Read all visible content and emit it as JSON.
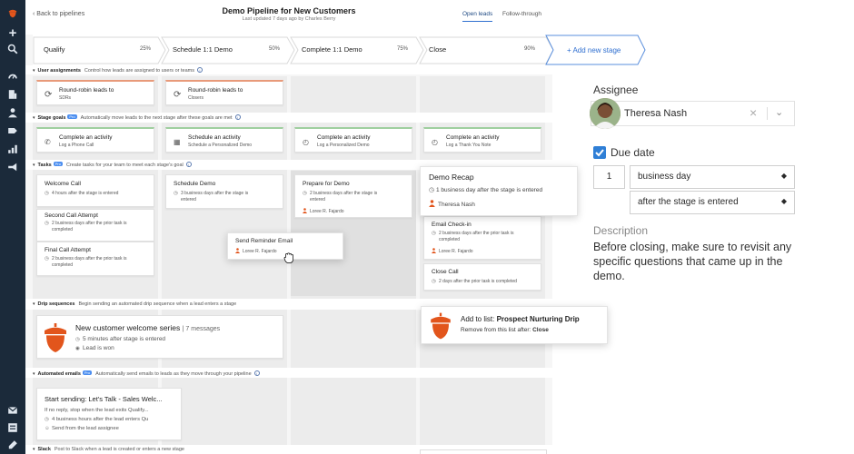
{
  "header": {
    "back_label": "Back to pipelines",
    "title": "Demo Pipeline for New Customers",
    "subtitle": "Last updated 7 days ago by Charles Berry",
    "tabs": [
      {
        "label": "Open leads",
        "active": true
      },
      {
        "label": "Follow-through",
        "active": false
      }
    ]
  },
  "stages": [
    {
      "name": "Qualify",
      "percent": "25%"
    },
    {
      "name": "Schedule 1:1 Demo",
      "percent": "50%"
    },
    {
      "name": "Complete 1:1 Demo",
      "percent": "75%"
    },
    {
      "name": "Close",
      "percent": "90%"
    }
  ],
  "add_stage_label": "+ Add new stage",
  "sections": {
    "user_assignments": {
      "title": "User assignments",
      "desc": "Control how leads are assigned to users or teams"
    },
    "stage_goals": {
      "title": "Stage goals",
      "badge": "Pro",
      "desc": "Automatically move leads to the next stage after these goals are met"
    },
    "tasks": {
      "title": "Tasks",
      "badge": "Pro",
      "desc": "Create tasks for your team to meet each stage's goal"
    },
    "drip": {
      "title": "Drip sequences",
      "desc": "Begin sending an automated drip sequence when a lead enters a stage"
    },
    "emails": {
      "title": "Automated emails",
      "badge": "Pro",
      "desc": "Automatically send emails to leads as they move through your pipeline"
    },
    "slack": {
      "title": "Slack",
      "desc": "Post to Slack when a lead is created or enters a new stage"
    }
  },
  "assignments": [
    {
      "title": "Round-robin leads to",
      "sub": "SDRs"
    },
    {
      "title": "Round-robin leads to",
      "sub": "Closers"
    }
  ],
  "goals": [
    {
      "title": "Complete an activity",
      "sub": "Log a Phone Call"
    },
    {
      "title": "Schedule an activity",
      "sub": "Schedule a Personalized Demo"
    },
    {
      "title": "Complete an activity",
      "sub": "Log a Personalized Demo"
    },
    {
      "title": "Complete an activity",
      "sub": "Log a Thank You Note"
    }
  ],
  "tasks": {
    "qualify": [
      {
        "title": "Welcome Call",
        "sub": "4 hours after the stage is entered"
      },
      {
        "title": "Second Call Attempt",
        "sub1": "2 business days after the prior task is",
        "sub2": "completed"
      },
      {
        "title": "Final Call Attempt",
        "sub1": "2 business days after the prior task is",
        "sub2": "completed"
      }
    ],
    "schedule": {
      "title": "Schedule Demo",
      "sub1": "3 business days after the stage is",
      "sub2": "entered"
    },
    "dragging": {
      "title": "Send Reminder Email",
      "assignee": "Loree R. Fajardo"
    },
    "complete": {
      "title": "Prepare for Demo",
      "sub1": "2 business days after the stage is",
      "sub2": "entered",
      "assignee": "Loree R. Fajardo"
    },
    "close": [
      {
        "title": "Email Check-in",
        "sub1": "2 business days after the prior task is",
        "sub2": "completed",
        "assignee": "Loree R. Fajardo"
      },
      {
        "title": "Close Call",
        "sub": "2 days after the prior task is completed"
      }
    ],
    "recap_popup": {
      "title": "Demo Recap",
      "sub": "1 business day after the stage is entered",
      "assignee": "Theresa Nash"
    }
  },
  "drip": {
    "card": {
      "title": "New customer welcome series",
      "count": "| 7 messages",
      "line1": "5 minutes after stage is entered",
      "line2": "Lead is won"
    },
    "popup": {
      "prefix": "Add to list: ",
      "list": "Prospect Nurturing Drip",
      "line2": "Remove from this list after: ",
      "after": "Close"
    }
  },
  "email": {
    "title": "Start sending: Let's Talk - Sales Welc...",
    "line1": "If no reply, stop when the lead exits Qualify...",
    "line2": "4 business hours after the lead enters Qu",
    "line3": "Send from the lead assignee"
  },
  "panel": {
    "assignee_label": "Assignee",
    "assignee_name": "Theresa Nash",
    "due_label": "Due date",
    "due_checked": true,
    "due_number": "1",
    "due_unit": "business day",
    "due_anchor": "after the stage is entered",
    "description_label": "Description",
    "description_text": "Before closing, make sure to revisit any specific questions that came up in the demo."
  },
  "colors": {
    "sidebar": "#1b2a3a",
    "accent": "#2f6fd0",
    "brand": "#e2551c",
    "checkbox": "#2f7fd6"
  }
}
